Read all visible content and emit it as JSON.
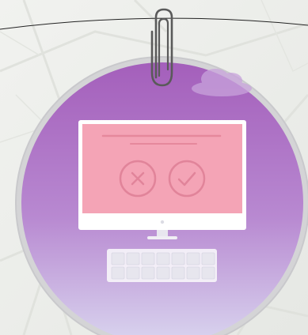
{
  "illustration": {
    "subject": "computer-monitor-with-cancel-and-confirm-icons",
    "icons": [
      "paperclip-icon",
      "cancel-icon",
      "confirm-icon",
      "keyboard-icon",
      "cloud-icon"
    ],
    "colors": {
      "background": "#eceeea",
      "badge_top": "#a45fbb",
      "badge_mid": "#b889d1",
      "badge_bottom": "#d9d5ef",
      "badge_rim": "#d4d4d6",
      "screen": "#f4a4b6",
      "screen_lines": "#e5889c",
      "monitor_frame": "#ffffff",
      "keyboard_key": "#eeeef2",
      "paperclip": "#5a5a5a"
    }
  }
}
